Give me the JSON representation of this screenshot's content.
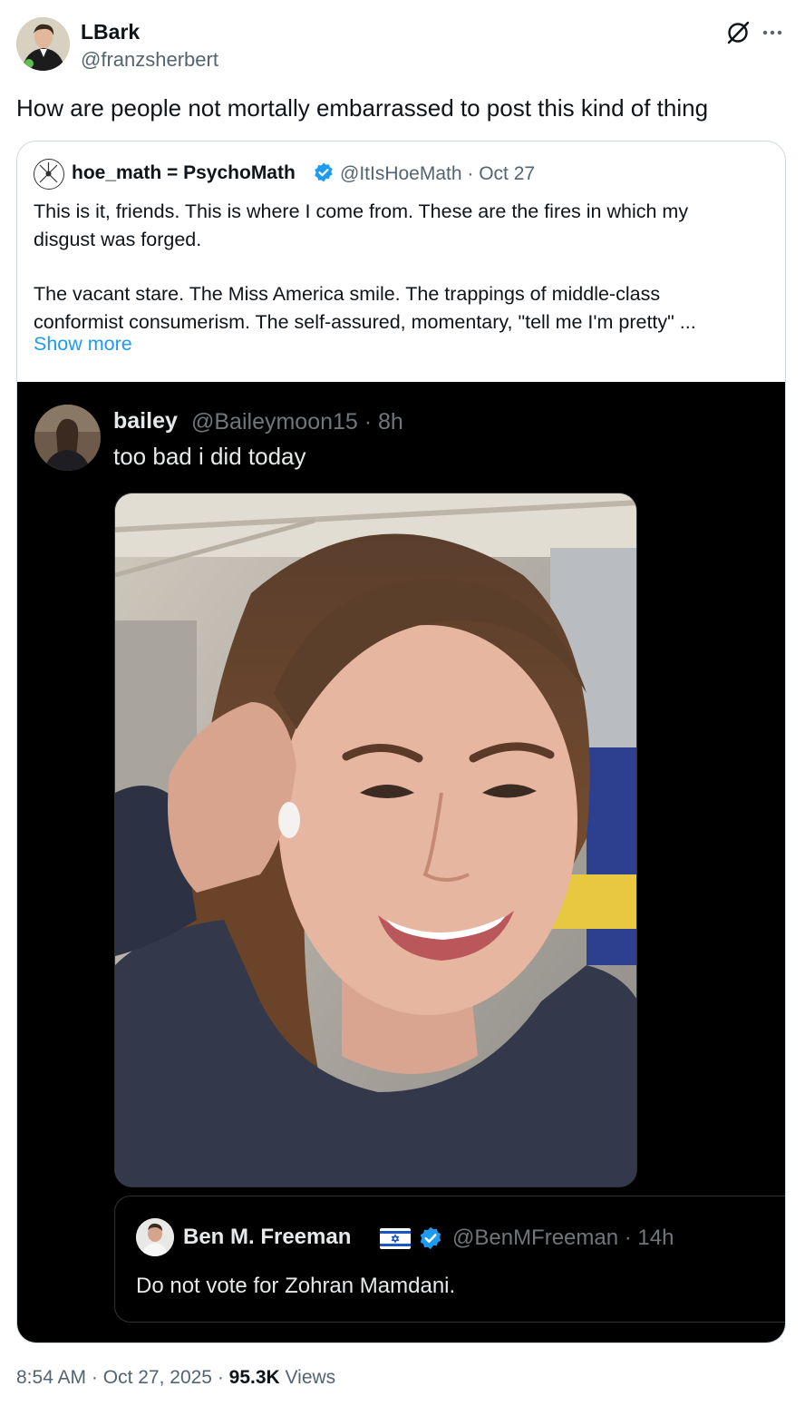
{
  "author": {
    "name": "LBark",
    "handle": "@franzsherbert"
  },
  "tweet": {
    "text": "How are people not mortally embarrassed to post this kind of thing"
  },
  "quoted": {
    "name": "hoe_math = PsychoMath",
    "handle_date": "@ItIsHoeMath · Oct 27",
    "line1": "This is it, friends. This is where I come from. These are the fires in which my",
    "line2": "disgust was forged.",
    "line3": "The vacant stare. The Miss America smile. The trappings of middle-class",
    "line4": "conformist consumerism. The self-assured, momentary, \"tell me I'm pretty\" ...",
    "show_more": "Show more",
    "embed": {
      "name": "bailey",
      "handle_time": "@Baileymoon15 · 8h",
      "text": "too bad i did today",
      "inner": {
        "name": "Ben M. Freeman",
        "handle_time": "@BenMFreeman · 14h",
        "text": "Do not vote for Zohran Mamdani."
      }
    }
  },
  "footer": {
    "time": "8:54 AM",
    "sep1": " · ",
    "date": "Oct 27, 2025",
    "sep2": " · ",
    "views_count": "95.3K",
    "views_label": " Views"
  },
  "icons": {
    "grok": "grok-slash-circle-icon",
    "more": "more-dots-icon",
    "verified": "verified-badge-icon",
    "flag": "israel-flag-icon"
  },
  "colors": {
    "link": "#1d9bf0",
    "secondary": "#536471",
    "verified": "#1d9bf0"
  }
}
